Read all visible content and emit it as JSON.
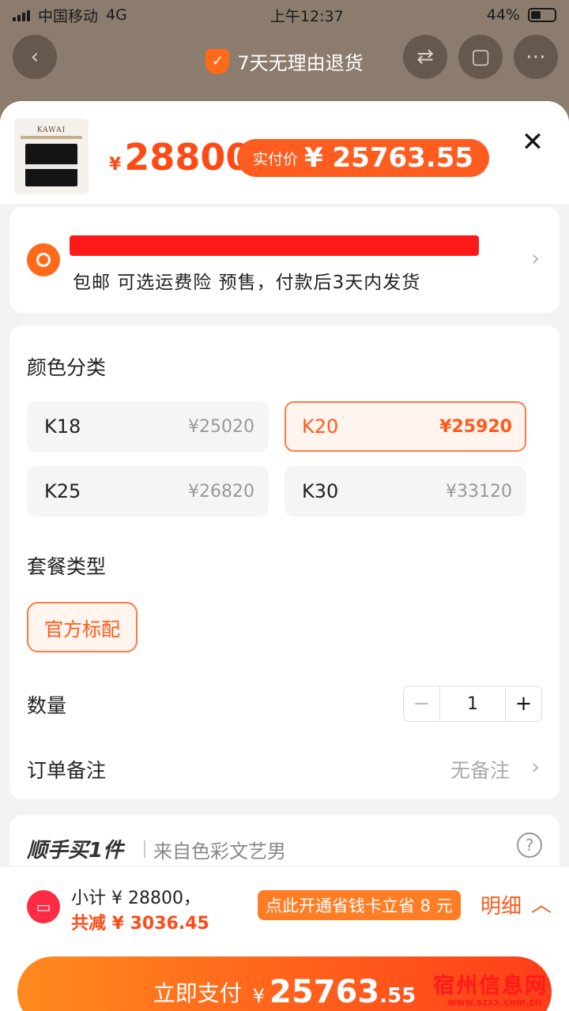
{
  "status": {
    "carrier": "中国移动",
    "network": "4G",
    "time": "上午12:37",
    "battery": "44%"
  },
  "banner": {
    "guarantee": "7天无理由退货"
  },
  "product": {
    "image_brand": "KAWAI",
    "price_symbol": "¥",
    "price": "28800",
    "real_label": "实付价",
    "real_price": "¥ 25763.55"
  },
  "address": {
    "shipping": "包邮  可选运费险  预售，付款后3天内发货"
  },
  "color": {
    "title": "颜色分类",
    "options": [
      {
        "name": "K18",
        "price": "¥25020",
        "selected": false
      },
      {
        "name": "K20",
        "price": "¥25920",
        "selected": true
      },
      {
        "name": "K25",
        "price": "¥26820",
        "selected": false
      },
      {
        "name": "K30",
        "price": "¥33120",
        "selected": false
      }
    ]
  },
  "package": {
    "title": "套餐类型",
    "option": "官方标配"
  },
  "quantity": {
    "label": "数量",
    "value": "1",
    "minus": "−",
    "plus": "+"
  },
  "note": {
    "label": "订单备注",
    "value": "无备注"
  },
  "addon": {
    "title": "顺手买1件",
    "from": "来自色彩文艺男",
    "help": "?"
  },
  "footer": {
    "subtotal": "小计 ¥ 28800，",
    "discount": "共减 ¥ 3036.45",
    "saver": "点此开通省钱卡立省 8 元",
    "detail": "明细",
    "pay_label": "立即支付",
    "pay_symbol": "¥",
    "pay_int": "25763",
    "pay_dec": ".55"
  },
  "watermark": {
    "text": "宿州信息网",
    "url": "www.szxx.com.cn"
  },
  "colors": {
    "accent": "#ff5a1a",
    "redact": "#ff1a1a"
  }
}
